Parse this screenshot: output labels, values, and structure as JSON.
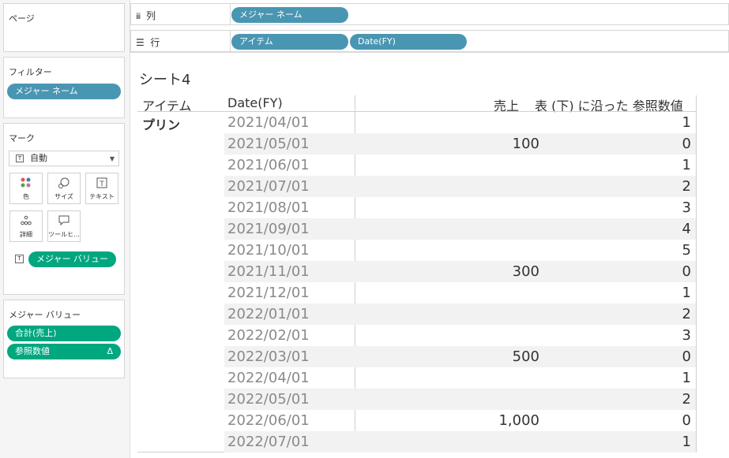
{
  "pages": {
    "title": "ページ"
  },
  "filters": {
    "title": "フィルター",
    "pill": "メジャー ネーム"
  },
  "marks": {
    "title": "マーク",
    "type": "自動",
    "buttons": {
      "color": "色",
      "size": "サイズ",
      "text": "テキスト",
      "detail": "詳細",
      "tooltip": "ツールヒ..."
    },
    "pill": "メジャー バリュー"
  },
  "measure_values": {
    "title": "メジャー バリュー",
    "items": [
      {
        "label": "合計(売上)"
      },
      {
        "label": "参照数値",
        "badge": "Δ"
      }
    ]
  },
  "columns_shelf": {
    "label": "列",
    "pills": [
      "メジャー ネーム"
    ]
  },
  "rows_shelf": {
    "label": "行",
    "pills": [
      "アイテム",
      "Date(FY)"
    ]
  },
  "sheet": {
    "title": "シート4",
    "headers": {
      "item": "アイテム",
      "date": "Date(FY)",
      "sales": "売上",
      "ref": "表 (下) に沿った 参照数値"
    },
    "item_value": "プリン",
    "rows": [
      {
        "date": "2021/04/01",
        "sales": "",
        "ref": "1"
      },
      {
        "date": "2021/05/01",
        "sales": "100",
        "ref": "0"
      },
      {
        "date": "2021/06/01",
        "sales": "",
        "ref": "1"
      },
      {
        "date": "2021/07/01",
        "sales": "",
        "ref": "2"
      },
      {
        "date": "2021/08/01",
        "sales": "",
        "ref": "3"
      },
      {
        "date": "2021/09/01",
        "sales": "",
        "ref": "4"
      },
      {
        "date": "2021/10/01",
        "sales": "",
        "ref": "5"
      },
      {
        "date": "2021/11/01",
        "sales": "300",
        "ref": "0"
      },
      {
        "date": "2021/12/01",
        "sales": "",
        "ref": "1"
      },
      {
        "date": "2022/01/01",
        "sales": "",
        "ref": "2"
      },
      {
        "date": "2022/02/01",
        "sales": "",
        "ref": "3"
      },
      {
        "date": "2022/03/01",
        "sales": "500",
        "ref": "0"
      },
      {
        "date": "2022/04/01",
        "sales": "",
        "ref": "1"
      },
      {
        "date": "2022/05/01",
        "sales": "",
        "ref": "2"
      },
      {
        "date": "2022/06/01",
        "sales": "1,000",
        "ref": "0"
      },
      {
        "date": "2022/07/01",
        "sales": "",
        "ref": "1"
      }
    ]
  },
  "colors": {
    "dimension_pill": "#4996b2",
    "measure_pill": "#00a77f"
  }
}
